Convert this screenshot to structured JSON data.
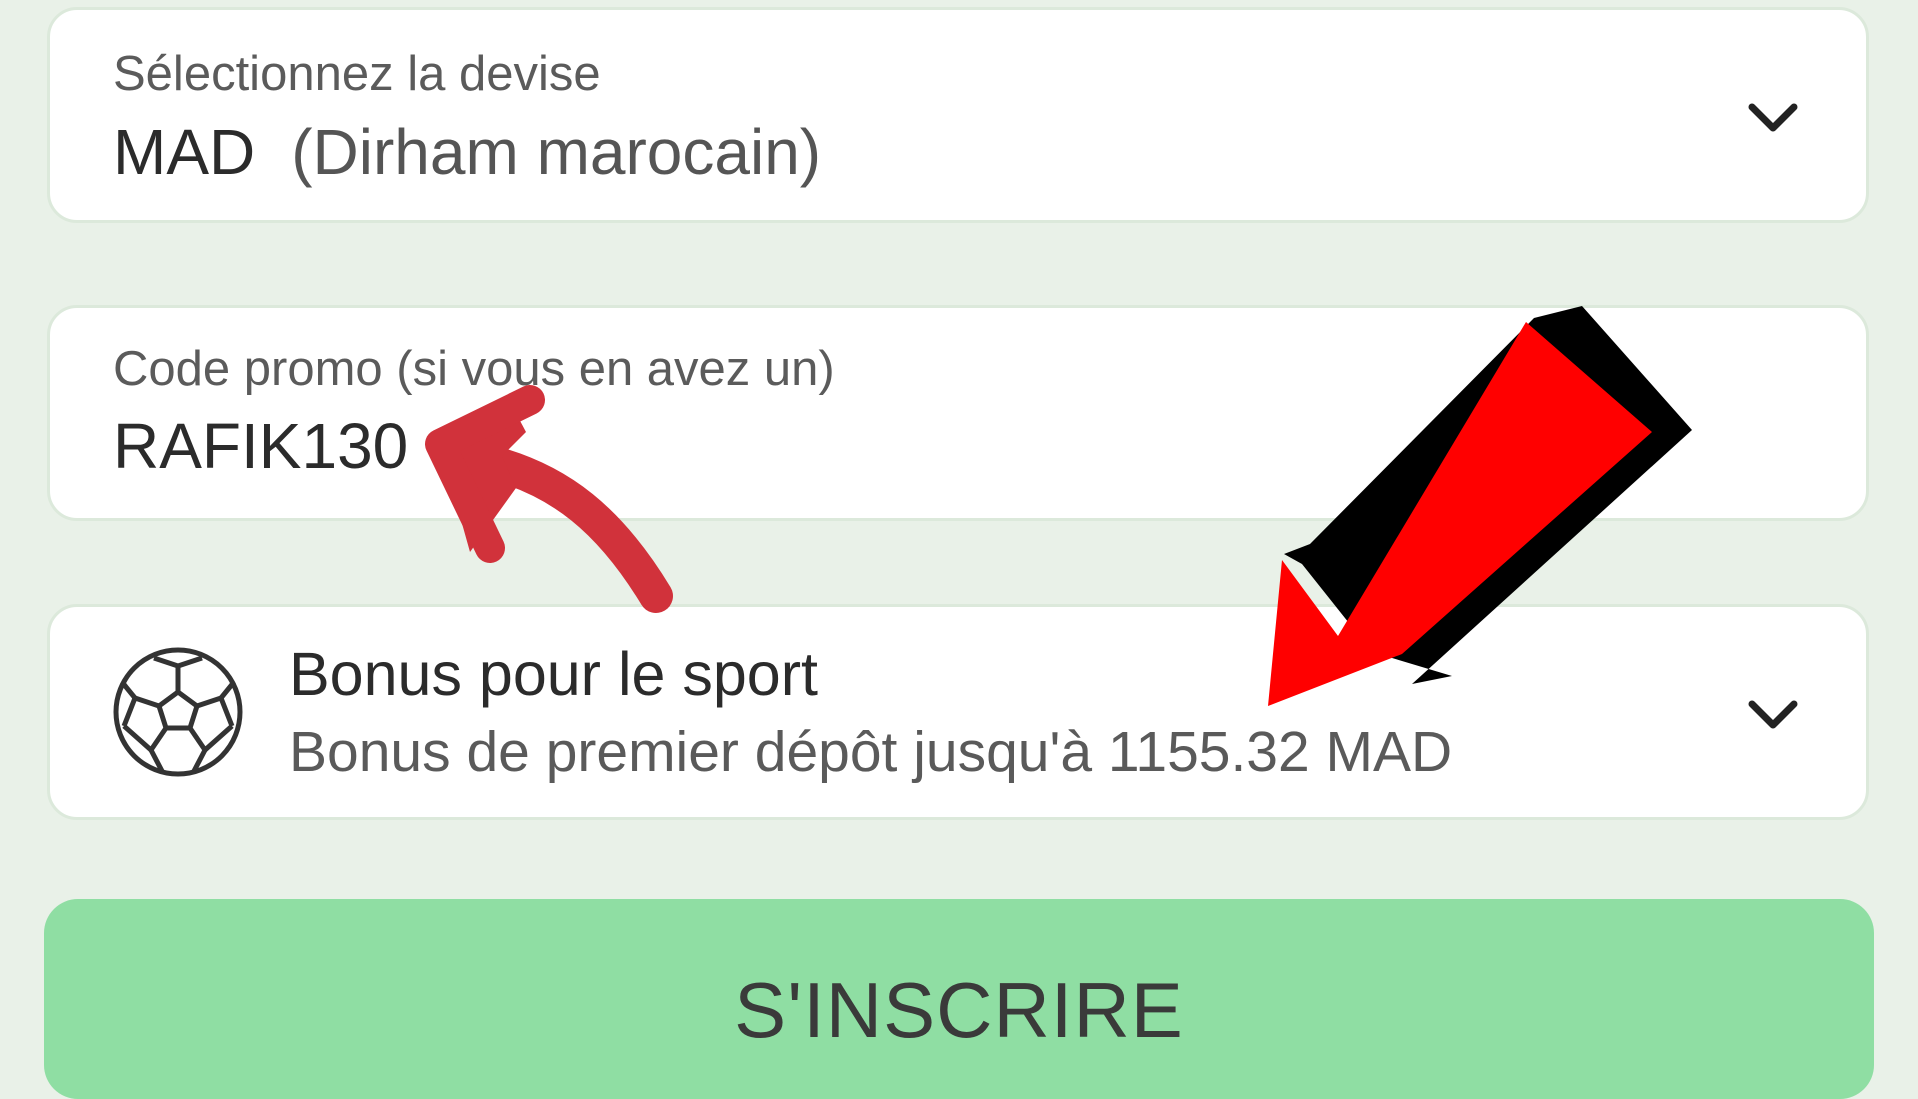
{
  "currency": {
    "label": "Sélectionnez la devise",
    "code": "MAD",
    "name": "(Dirham marocain)",
    "icon": "chevron-down-icon"
  },
  "promo": {
    "label": "Code promo (si vous en avez un)",
    "value": "RAFIK130"
  },
  "bonus": {
    "title": "Bonus pour le sport",
    "subtitle": "Bonus de premier dépôt jusqu'à 1155.32 MAD",
    "icon": "soccer-ball-icon",
    "expand_icon": "chevron-down-icon"
  },
  "signup": {
    "label": "S'INSCRIRE"
  },
  "colors": {
    "background": "#e9f1e8",
    "card": "#ffffff",
    "card_border": "#dce9db",
    "button": "#8fdea3",
    "annotation_red": "#ff0000",
    "curved_arrow_red": "#d1323b"
  }
}
